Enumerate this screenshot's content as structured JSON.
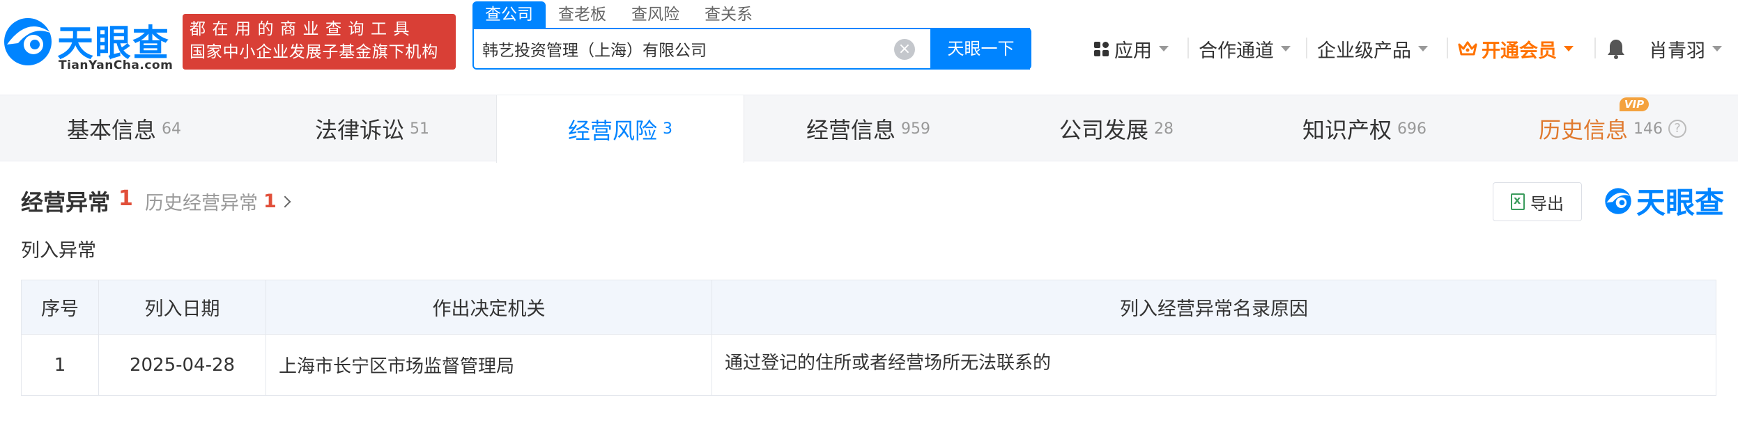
{
  "header": {
    "logo_text": "天眼查",
    "logo_domain": "TianYanCha.com",
    "slogan_line1": "都在用的商业查询工具",
    "slogan_line2": "国家中小企业发展子基金旗下机构",
    "search_tabs": [
      "查公司",
      "查老板",
      "查风险",
      "查关系"
    ],
    "search_value": "韩艺投资管理（上海）有限公司",
    "search_button": "天眼一下",
    "nav": {
      "apps": "应用",
      "channel": "合作通道",
      "enterprise": "企业级产品",
      "vip": "开通会员",
      "user": "肖青羽"
    },
    "colors": {
      "brand": "#0084ff",
      "slogan_bg": "#d93f36",
      "vip": "#ff7200"
    }
  },
  "tabs": [
    {
      "label": "基本信息",
      "count": "64"
    },
    {
      "label": "法律诉讼",
      "count": "51"
    },
    {
      "label": "经营风险",
      "count": "3"
    },
    {
      "label": "经营信息",
      "count": "959"
    },
    {
      "label": "公司发展",
      "count": "28"
    },
    {
      "label": "知识产权",
      "count": "696"
    },
    {
      "label": "历史信息",
      "count": "146",
      "badge": "VIP"
    }
  ],
  "section": {
    "title": "经营异常",
    "count": "1",
    "history_label": "历史经营异常",
    "history_count": "1",
    "export_label": "导出",
    "brand": "天眼查",
    "subtitle": "列入异常"
  },
  "table": {
    "headers": [
      "序号",
      "列入日期",
      "作出决定机关",
      "列入经营异常名录原因"
    ],
    "rows": [
      {
        "index": "1",
        "date": "2025-04-28",
        "authority": "上海市长宁区市场监督管理局",
        "reason": "通过登记的住所或者经营场所无法联系的"
      }
    ]
  }
}
